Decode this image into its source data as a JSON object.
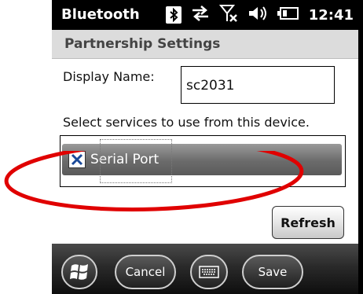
{
  "status_bar": {
    "title": "Bluetooth",
    "time": "12:41",
    "icons": [
      "bluetooth-icon",
      "data-sync-icon",
      "no-signal-icon",
      "volume-icon",
      "battery-icon"
    ]
  },
  "header": {
    "title": "Partnership Settings"
  },
  "form": {
    "display_name_label": "Display Name:",
    "display_name_value": "sc2031",
    "services_label": "Select services to use from this device."
  },
  "services": [
    {
      "label": "Serial Port",
      "checked": true
    }
  ],
  "refresh_label": "Refresh",
  "bottom_bar": {
    "start_icon": "windows-logo-icon",
    "cancel_label": "Cancel",
    "keyboard_icon": "keyboard-icon",
    "save_label": "Save"
  },
  "colors": {
    "status_bg": "#000000",
    "header_bg": "#dcdcdc",
    "selected_item": "#6b6b6b",
    "annotation": "#e00000"
  }
}
